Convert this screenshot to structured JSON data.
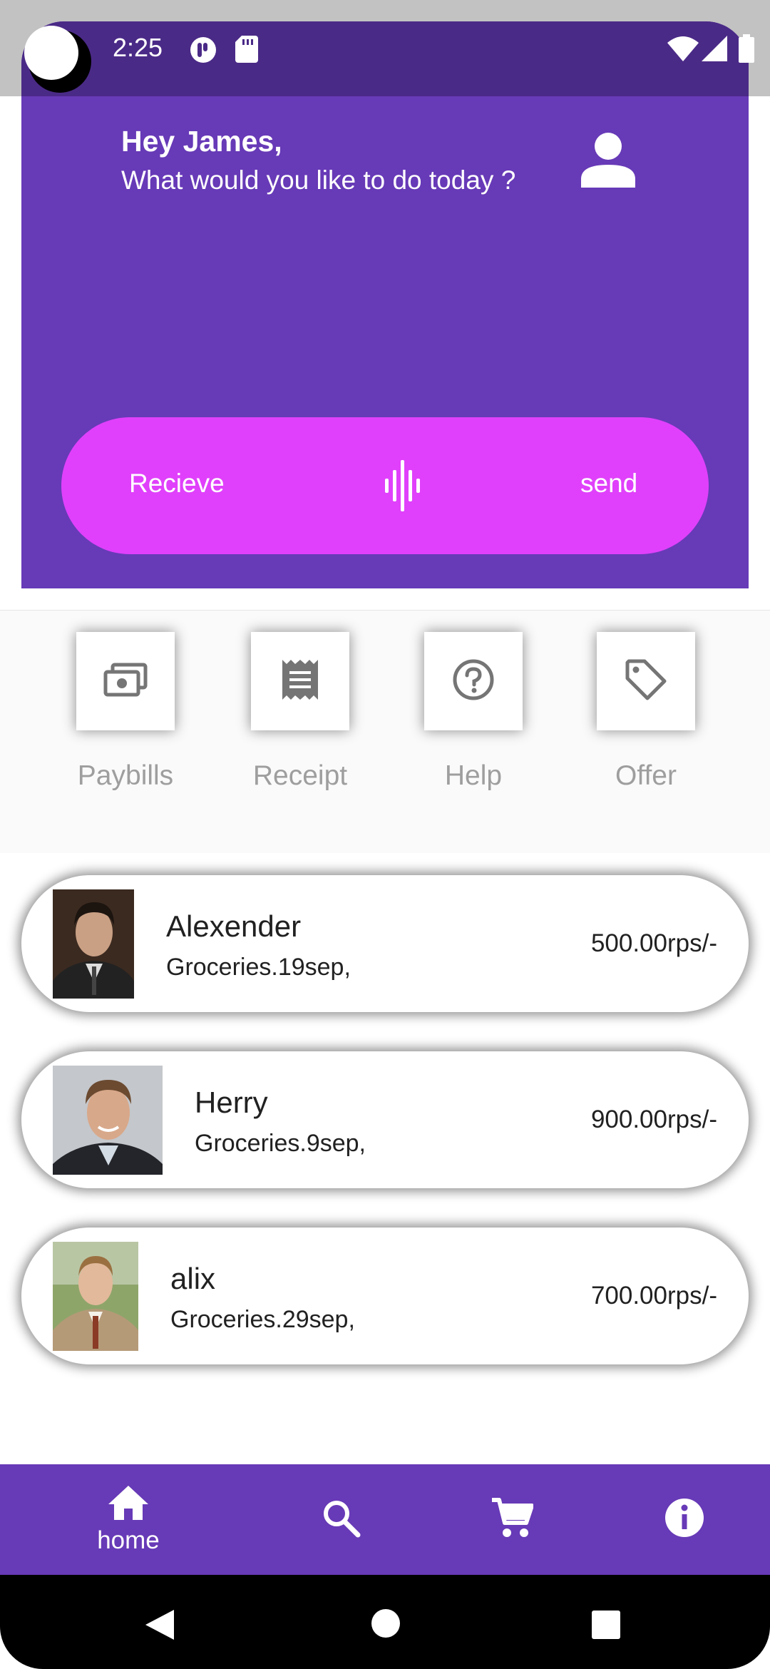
{
  "status_bar": {
    "time": "2:25"
  },
  "header": {
    "greeting": "Hey James,",
    "subtitle": "What would you like to do today ?"
  },
  "actions": {
    "receive_label": "Recieve",
    "send_label": "send"
  },
  "quick_actions": [
    {
      "label": "Paybills",
      "icon": "paybills-icon"
    },
    {
      "label": "Receipt",
      "icon": "receipt-icon"
    },
    {
      "label": "Help",
      "icon": "help-icon"
    },
    {
      "label": "Offer",
      "icon": "offer-tag-icon"
    }
  ],
  "transactions": [
    {
      "name": "Alexender",
      "detail": "Groceries.19sep,",
      "amount": "500.00rps/-"
    },
    {
      "name": "Herry",
      "detail": "Groceries.9sep,",
      "amount": "900.00rps/-"
    },
    {
      "name": "alix",
      "detail": "Groceries.29sep,",
      "amount": "700.00rps/-"
    }
  ],
  "bottom_nav": {
    "home_label": "home",
    "items": [
      "home-icon",
      "search-icon",
      "cart-icon",
      "info-icon"
    ]
  },
  "colors": {
    "primary": "#673ab7",
    "status_bar": "#4a2a87",
    "accent": "#e040fb",
    "muted_text": "#9e9e9e"
  }
}
